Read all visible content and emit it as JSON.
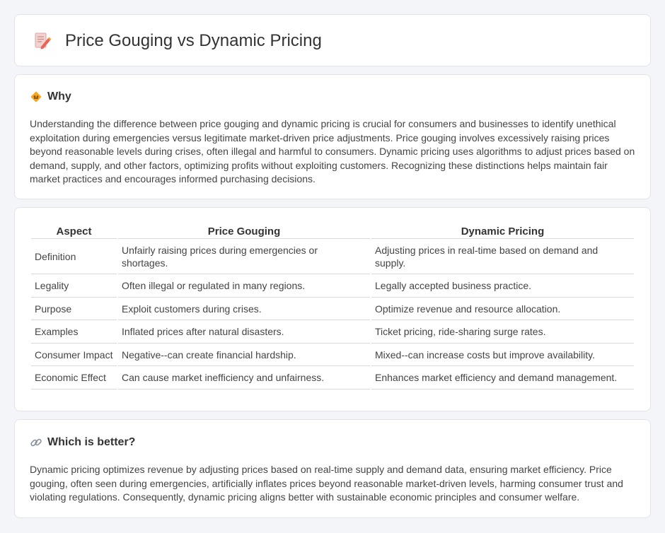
{
  "header": {
    "title": "Price Gouging vs Dynamic Pricing",
    "icon": "document-pencil-icon"
  },
  "why": {
    "heading": "Why",
    "icon": "diamond-sign-icon",
    "text": "Understanding the difference between price gouging and dynamic pricing is crucial for consumers and businesses to identify unethical exploitation during emergencies versus legitimate market-driven price adjustments. Price gouging involves excessively raising prices beyond reasonable levels during crises, often illegal and harmful to consumers. Dynamic pricing uses algorithms to adjust prices based on demand, supply, and other factors, optimizing profits without exploiting customers. Recognizing these distinctions helps maintain fair market practices and encourages informed purchasing decisions."
  },
  "comparison": {
    "columns": [
      "Aspect",
      "Price Gouging",
      "Dynamic Pricing"
    ],
    "rows": [
      [
        "Definition",
        "Unfairly raising prices during emergencies or shortages.",
        "Adjusting prices in real-time based on demand and supply."
      ],
      [
        "Legality",
        "Often illegal or regulated in many regions.",
        "Legally accepted business practice."
      ],
      [
        "Purpose",
        "Exploit customers during crises.",
        "Optimize revenue and resource allocation."
      ],
      [
        "Examples",
        "Inflated prices after natural disasters.",
        "Ticket pricing, ride-sharing surge rates."
      ],
      [
        "Consumer Impact",
        "Negative--can create financial hardship.",
        "Mixed--can increase costs but improve availability."
      ],
      [
        "Economic Effect",
        "Can cause market inefficiency and unfairness.",
        "Enhances market efficiency and demand management."
      ]
    ]
  },
  "better": {
    "heading": "Which is better?",
    "icon": "link-icon",
    "text": "Dynamic pricing optimizes revenue by adjusting prices based on real-time supply and demand data, ensuring market efficiency. Price gouging, often seen during emergencies, artificially inflates prices beyond reasonable market-driven levels, harming consumer trust and violating regulations. Consequently, dynamic pricing aligns better with sustainable economic principles and consumer welfare."
  },
  "colors": {
    "background": "#f4f5f9",
    "card": "#ffffff",
    "border": "#e2e4ea",
    "diamond_sign": "#f5a623",
    "doc_icon": "#e8655a"
  }
}
